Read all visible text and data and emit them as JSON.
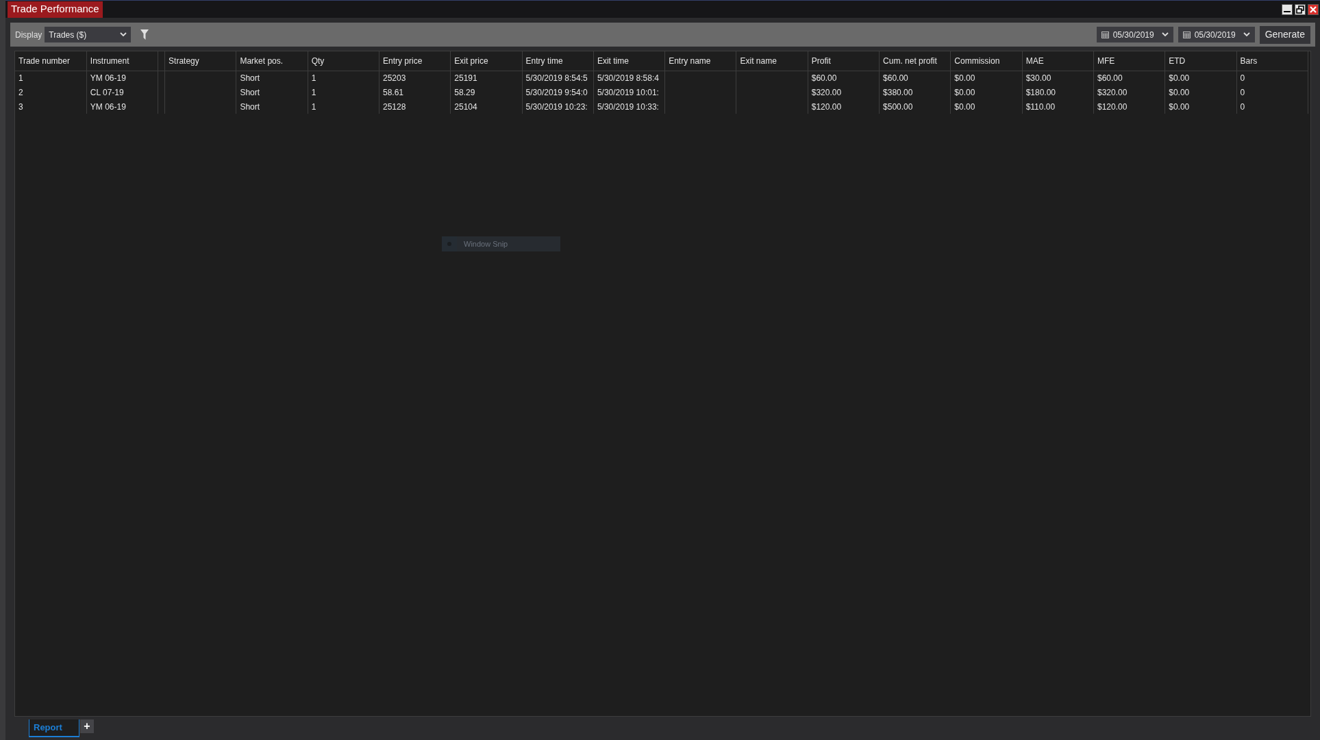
{
  "window": {
    "title": "Trade Performance"
  },
  "toolbar": {
    "display_label": "Display",
    "display_value": "Trades ($)",
    "start_date": "05/30/2019",
    "end_date": "05/30/2019",
    "generate": "Generate"
  },
  "table": {
    "columns": [
      "Trade number",
      "Instrument",
      "Strategy",
      "Market pos.",
      "Qty",
      "Entry price",
      "Exit price",
      "Entry time",
      "Exit time",
      "Entry name",
      "Exit name",
      "Profit",
      "Cum. net profit",
      "Commission",
      "MAE",
      "MFE",
      "ETD",
      "Bars"
    ],
    "rows": [
      [
        "1",
        "YM 06-19",
        "",
        "Short",
        "1",
        "25203",
        "25191",
        "5/30/2019 8:54:5",
        "5/30/2019 8:58:4",
        "",
        "",
        "$60.00",
        "$60.00",
        "$0.00",
        "$30.00",
        "$60.00",
        "$0.00",
        "0"
      ],
      [
        "2",
        "CL 07-19",
        "",
        "Short",
        "1",
        "58.61",
        "58.29",
        "5/30/2019 9:54:0",
        "5/30/2019 10:01:",
        "",
        "",
        "$320.00",
        "$380.00",
        "$0.00",
        "$180.00",
        "$320.00",
        "$0.00",
        "0"
      ],
      [
        "3",
        "YM 06-19",
        "",
        "Short",
        "1",
        "25128",
        "25104",
        "5/30/2019 10:23:",
        "5/30/2019 10:33:",
        "",
        "",
        "$120.00",
        "$500.00",
        "$0.00",
        "$110.00",
        "$120.00",
        "$0.00",
        "0"
      ]
    ]
  },
  "snip_overlay": {
    "label": "Window Snip"
  },
  "tabs": [
    {
      "label": "Report",
      "selected": true
    }
  ],
  "add_tab": "+"
}
